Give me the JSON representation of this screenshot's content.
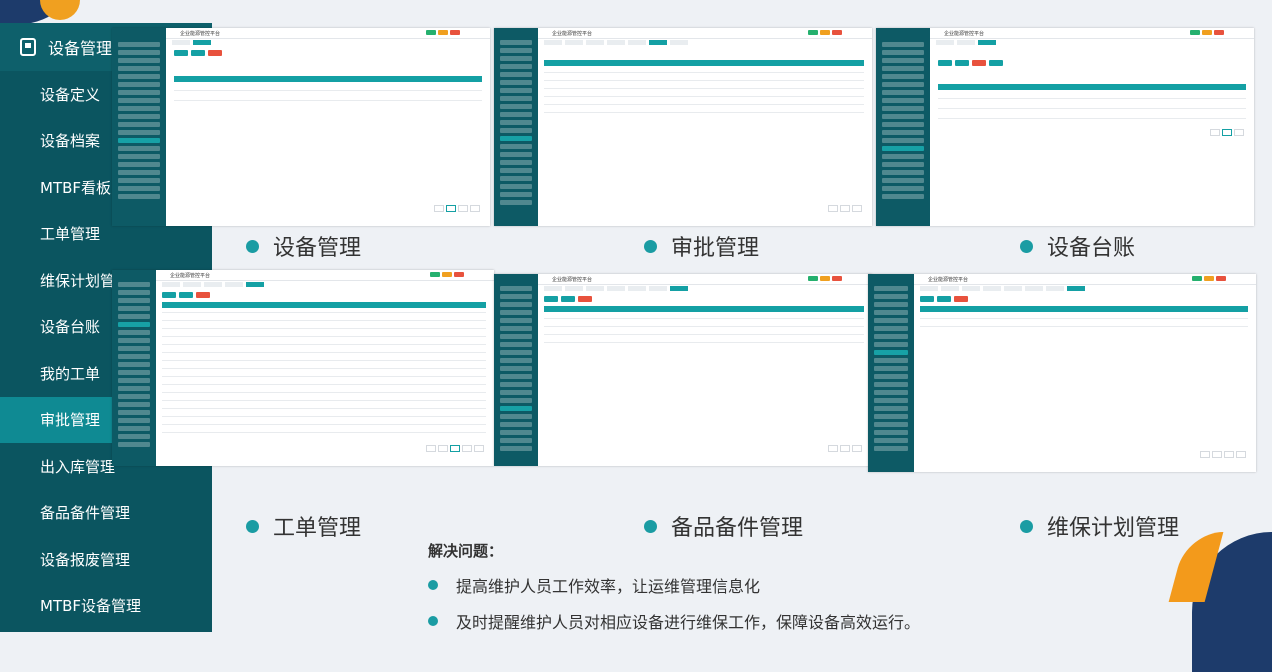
{
  "sidebar": {
    "title": "设备管理",
    "items": [
      {
        "label": "设备定义",
        "active": false
      },
      {
        "label": "设备档案",
        "active": false
      },
      {
        "label": "MTBF看板",
        "active": false
      },
      {
        "label": "工单管理",
        "active": false
      },
      {
        "label": "维保计划管理",
        "active": false
      },
      {
        "label": "设备台账",
        "active": false
      },
      {
        "label": "我的工单",
        "active": false
      },
      {
        "label": "审批管理",
        "active": true
      },
      {
        "label": "出入库管理",
        "active": false
      },
      {
        "label": "备品备件管理",
        "active": false
      },
      {
        "label": "设备报废管理",
        "active": false
      },
      {
        "label": "MTBF设备管理",
        "active": false
      }
    ]
  },
  "screenshots": {
    "app_title": "企业能源管控平台"
  },
  "captions": {
    "device_management": "设备管理",
    "approval_management": "审批管理",
    "device_ledger": "设备台账",
    "work_order_management": "工单管理",
    "spare_parts_management": "备品备件管理",
    "maintenance_plan_management": "维保计划管理"
  },
  "problems": {
    "title": "解决问题：",
    "points": [
      "提高维护人员工作效率，让运维管理信息化",
      "及时提醒维护人员对相应设备进行维保工作，保障设备高效运行。"
    ]
  },
  "colors": {
    "sidebar_bg": "#0b5560",
    "sidebar_active": "#0f8a93",
    "accent_teal": "#1a9ca3",
    "corner_navy": "#1d3b6b",
    "corner_orange": "#f39a1b"
  }
}
